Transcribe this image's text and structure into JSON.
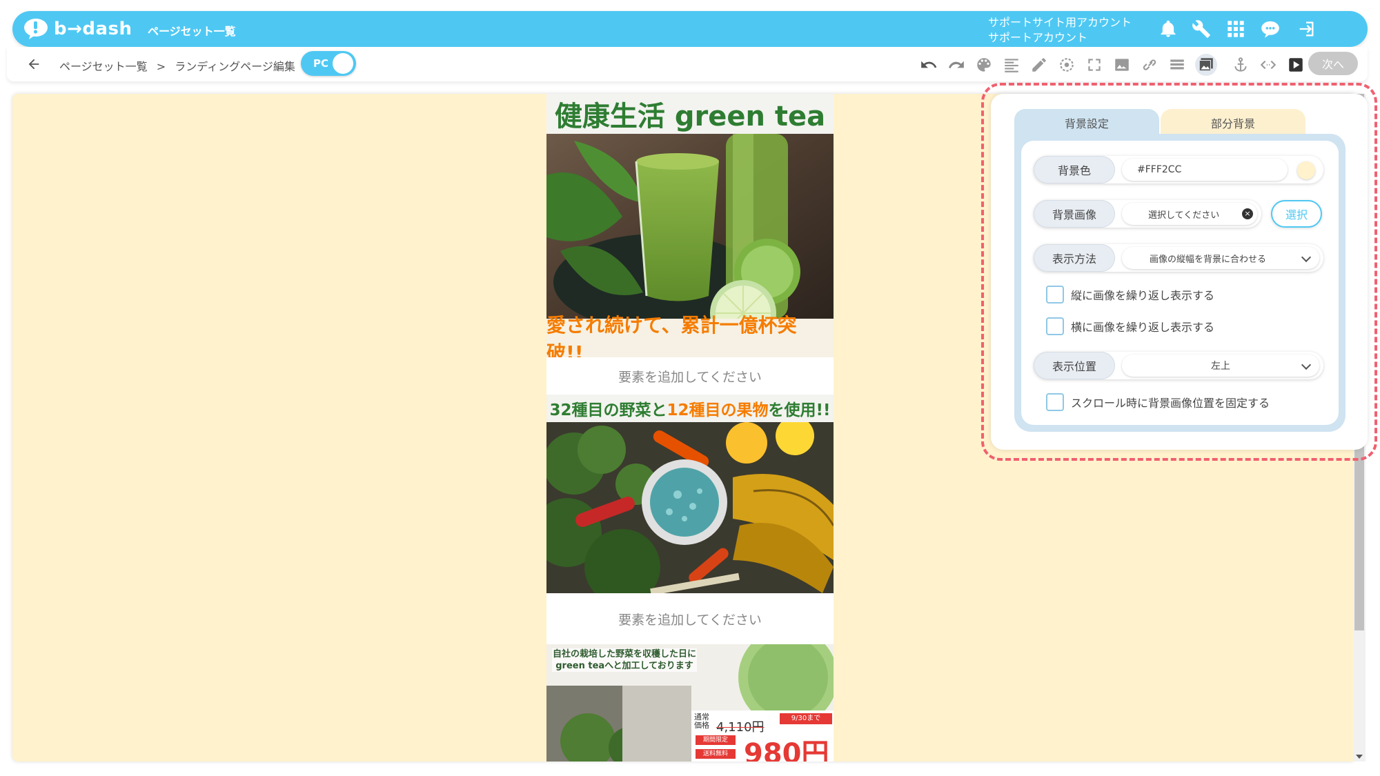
{
  "header": {
    "logo_text": "b→dash",
    "nav_title": "ページセット一覧",
    "account_line1": "サポートサイト用アカウント",
    "account_line2": "サポートアカウント",
    "icons": [
      "bell-icon",
      "wrench-icon",
      "grid-icon",
      "chat-icon",
      "logout-icon"
    ]
  },
  "toolbar": {
    "breadcrumb": [
      "ページセット一覧",
      ">",
      "ランディングページ編集"
    ],
    "device_toggle": "PC",
    "icons": [
      "undo-icon",
      "redo-icon",
      "palette-icon",
      "align-icon",
      "pen-icon",
      "target-icon",
      "expand-icon",
      "image-icon",
      "link-icon",
      "table-icon",
      "background-image-icon",
      "anchor-icon",
      "code-icon",
      "play-icon"
    ],
    "next_label": "次へ"
  },
  "canvas": {
    "background_color": "#FFF2CC",
    "lp": {
      "heading1": "健康生活 green tea",
      "banner1": "愛され続けて、累計一億杯突破!!",
      "add_element_1": "要素を追加してください",
      "heading2_part1": "32種目の野菜",
      "heading2_part2": "と",
      "heading2_part3": "12種目の果物",
      "heading2_part4": "を使用!!",
      "add_element_2": "要素を追加してください",
      "promo_text_line1": "自社の栽培した野菜を収穫した日に",
      "promo_text_line2": "green teaへと加工しております",
      "price_label": "通常価格",
      "price_old": "4,110円",
      "price_deadline": "9/30まで",
      "price_badge1": "期間限定",
      "price_badge2": "送料無料",
      "price_new": "980円"
    }
  },
  "panel": {
    "tabs": [
      "背景設定",
      "部分背景"
    ],
    "bg_color_label": "背景色",
    "bg_color_value": "#FFF2CC",
    "bg_image_label": "背景画像",
    "bg_image_placeholder": "選択してください",
    "bg_image_clear": "×",
    "select_button": "選択",
    "display_method_label": "表示方法",
    "display_method_value": "画像の縦幅を背景に合わせる",
    "repeat_vertical": "縦に画像を繰り返し表示する",
    "repeat_horizontal": "横に画像を繰り返し表示する",
    "position_label": "表示位置",
    "position_value": "左上",
    "fix_on_scroll": "スクロール時に背景画像位置を固定する"
  }
}
